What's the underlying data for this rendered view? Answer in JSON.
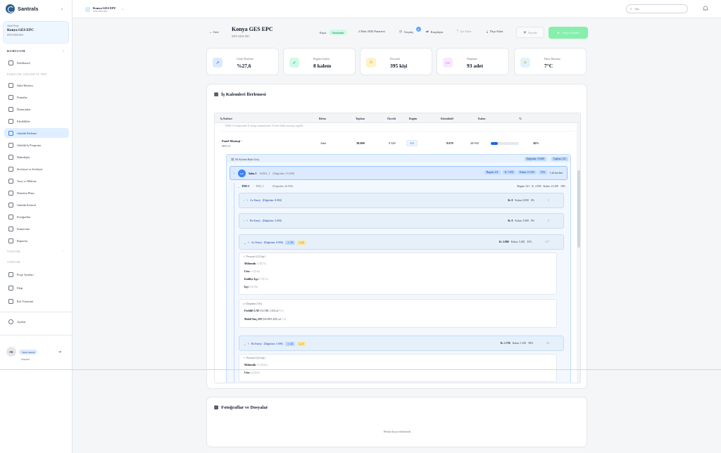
{
  "app": {
    "brand": "Santrals"
  },
  "project_card": {
    "small": "Aktif Proje",
    "name": "Konya GES EPC",
    "code": "SNT-GES-001"
  },
  "sidebar": {
    "section_kurulum": "KURULUM",
    "dashboard": "Dashboard",
    "sub_heading": "KURULUM, GÖZLEM VE TEST",
    "items": [
      {
        "label": "Saha Haritası",
        "icon": "map-icon"
      },
      {
        "label": "Firmalar",
        "icon": "building-icon"
      },
      {
        "label": "Donatımlar",
        "icon": "box-icon"
      },
      {
        "label": "Eksiklikler",
        "icon": "warning-icon"
      },
      {
        "label": "Günlük İlerleme",
        "icon": "trend-icon"
      },
      {
        "label": "Günlük İş Programı",
        "icon": "calendar-icon"
      },
      {
        "label": "Hakedişler",
        "icon": "document-icon"
      },
      {
        "label": "Sevkiyat ve Sevkiyat",
        "icon": "truck-icon"
      },
      {
        "label": "Araç ve Makine",
        "icon": "wrench-icon"
      },
      {
        "label": "Denetim Planı",
        "icon": "shield-icon"
      },
      {
        "label": "Günlük Kontrol",
        "icon": "layers-icon"
      },
      {
        "label": "Fotoğraflar",
        "icon": "image-icon"
      },
      {
        "label": "Kameralar",
        "icon": "camera-icon"
      },
      {
        "label": "Raporlar",
        "icon": "report-icon"
      }
    ],
    "section_yonetim": "YÖNETİM",
    "sub_yonetim": "YÖNETİM",
    "yonetim_items": [
      {
        "label": "Proje Ayarları",
        "icon": "pencil-icon"
      },
      {
        "label": "Ekip",
        "icon": "users-icon"
      },
      {
        "label": "Rol Yönetimi",
        "icon": "role-icon"
      }
    ],
    "settings": "Ayarlar",
    "user_initials": "FR",
    "user_name": "Yusuf Akkök",
    "user_role": "Yönetici"
  },
  "topbar": {
    "project_name": "Konya GES EPC",
    "project_code": "SNT-GES-001",
    "search_placeholder": "Ara..."
  },
  "header": {
    "back": "Geri",
    "title": "Konya GES EPC",
    "code": "SNT-GES-001",
    "status_label": "Kayıt",
    "status_badge": "Onaylandı",
    "date": "2 Mart 2026 Pazartesi",
    "history": "Geçmiş",
    "history_count": "10",
    "compare": "Karşılaştır",
    "share": "İşe Aktar",
    "export": "Dışa Aktar",
    "draft": "Kaydet",
    "submit": "Onaya Gönder"
  },
  "stats": [
    {
      "label": "Genel İlerleme",
      "value": "%27,6",
      "icon": "trend-up-icon",
      "color": "#dbeafe"
    },
    {
      "label": "Bugün Girilen",
      "value": "8 kalem",
      "icon": "check-circle-icon",
      "color": "#d1fae5"
    },
    {
      "label": "Personel",
      "value": "395 kişi",
      "icon": "people-icon",
      "color": "#fef3c7"
    },
    {
      "label": "Ekipman",
      "value": "93 adet",
      "icon": "truck-icon",
      "color": "#fae8ff"
    },
    {
      "label": "Hava Durumu",
      "value": "7°C",
      "icon": "sun-icon",
      "color": "#e0f2fe"
    }
  ],
  "progress_panel": {
    "title": "İş Kalemleri İlerlemesi",
    "columns": [
      "İş Kalemi",
      "Birim",
      "Toplam",
      "Önceki",
      "Bugün",
      "Kümülatif",
      "Kalan",
      "%"
    ],
    "note": "TM03-12 bölgesinde E-merge tamamlandı; 18 adet kablo montajı yapıldı.",
    "task": {
      "name": "Panel Montajı",
      "code": "MEK-01",
      "unit": "Adet",
      "total": "38.000",
      "previous": "9.349",
      "today": "321",
      "cumulative": "9.670",
      "remaining": "28.930",
      "percent": "26%",
      "progress": 0.26
    },
    "breakdown": {
      "title": "Alt Kırılım Bazlı Giriş",
      "distributed": "Dağıtılan: 19.200",
      "total": "Toplam: 321",
      "saha": {
        "badge": "SA",
        "name": "Saha 1",
        "code": "SAHA_1",
        "distributed": "(Dağıtılan: 19.200)",
        "today": "Bugün: 411",
        "cumulative": "K: 7.670",
        "remaining": "Kalan: 11.530",
        "percent": "13%",
        "items": "1 alt kırılım"
      },
      "tm": {
        "name": "TM3-3",
        "code": "TM3_3",
        "distributed": "(Dağıtılan: 26.000)",
        "today": "Bugün: 321",
        "cumulative": "K: 4.930",
        "remaining": "Kalan: 21.450",
        "percent": "18%"
      },
      "groups": [
        {
          "name": "Ax Enerji",
          "distributed": "(Dağıtılan: 8.000)",
          "k": "K: 0",
          "remaining": "Kalan: 8.000",
          "percent": "0%",
          "last": "0"
        },
        {
          "name": "Bx Enerji",
          "distributed": "(Dağıtılan: 3.000)",
          "k": "K: 0",
          "remaining": "Kalan: 3.000",
          "percent": "0%",
          "last": "0"
        },
        {
          "name": "Ax Enerji",
          "distributed": "(Dağıtılan: 8.000)",
          "people": "23",
          "equip": "2",
          "k": "K: 2.800",
          "remaining": "Kalan: 5.200",
          "percent": "35%",
          "last": "327"
        },
        {
          "name": "Bx Enerji",
          "distributed": "(Dağıtılan: 3.000)",
          "people": "22",
          "equip": "1",
          "k": "K: 1.750",
          "remaining": "Kalan: 1.250",
          "percent": "58%",
          "last": "84"
        }
      ],
      "personnel_title": "Personel (23 kişi)",
      "personnel": [
        {
          "role": "Mühendis",
          "count": "x1",
          "hours": "(8,7s)"
        },
        {
          "role": "Usta",
          "count": "x1",
          "hours": "(9,4s)"
        },
        {
          "role": "Kalifiye İşçi",
          "count": "x7",
          "hours": "(8,7s)"
        },
        {
          "role": "İşçi",
          "count": "x14",
          "hours": "(9s)"
        }
      ],
      "equipment_title": "Ekipman (14s)",
      "equipment": [
        {
          "name": "Forklift CAT",
          "detail": "(34 ABC 123)",
          "count": "x2",
          "hours": "9,5s"
        },
        {
          "name": "Mobil Vinç 25T",
          "detail": "(06 DEF 456)",
          "count": "x2",
          "hours": "7,5s"
        }
      ],
      "personnel2_title": "Personel (22 kişi)",
      "personnel2": [
        {
          "role": "Mühendis",
          "count": "x1",
          "hours": "(10,4s)"
        },
        {
          "role": "Usta",
          "count": "x2",
          "hours": "(8,8s)"
        }
      ]
    }
  },
  "photos_panel": {
    "title": "Fotoğraflar ve Dosyalar",
    "empty": "Henüz dosya eklenmedi."
  }
}
